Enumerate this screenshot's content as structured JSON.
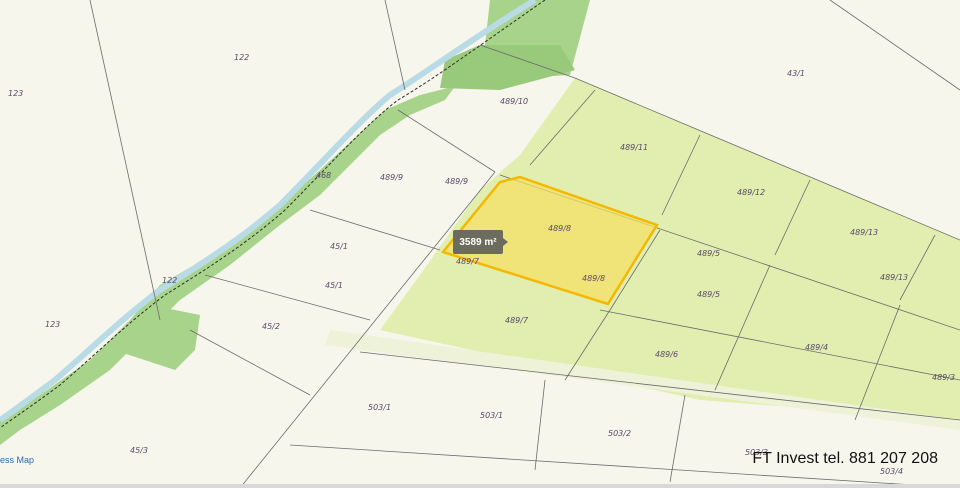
{
  "map": {
    "area_badge": "3589 m²",
    "watermark": "FT Invest tel. 881 207 208",
    "edge_link": "ess Map",
    "parcel_labels": [
      {
        "id": "123",
        "text": "123"
      },
      {
        "id": "122-top",
        "text": "122"
      },
      {
        "id": "122-mid",
        "text": "122"
      },
      {
        "id": "468",
        "text": "468"
      },
      {
        "id": "123-bottom",
        "text": "123"
      },
      {
        "id": "489-10",
        "text": "489/10"
      },
      {
        "id": "489-9-a",
        "text": "489/9"
      },
      {
        "id": "489-9-b",
        "text": "489/9"
      },
      {
        "id": "45-1-a",
        "text": "45/1"
      },
      {
        "id": "45-1-b",
        "text": "45/1"
      },
      {
        "id": "45-2",
        "text": "45/2"
      },
      {
        "id": "45-3",
        "text": "45/3"
      },
      {
        "id": "489-11",
        "text": "489/11"
      },
      {
        "id": "489-12",
        "text": "489/12"
      },
      {
        "id": "489-13-a",
        "text": "489/13"
      },
      {
        "id": "489-13-b",
        "text": "489/13"
      },
      {
        "id": "489-8-a",
        "text": "489/8"
      },
      {
        "id": "489-8-b",
        "text": "489/8"
      },
      {
        "id": "489-7-a",
        "text": "489/7"
      },
      {
        "id": "489-7-b",
        "text": "489/7"
      },
      {
        "id": "489-5-a",
        "text": "489/5"
      },
      {
        "id": "489-5-b",
        "text": "489/5"
      },
      {
        "id": "489-6",
        "text": "489/6"
      },
      {
        "id": "489-4",
        "text": "489/4"
      },
      {
        "id": "489-3",
        "text": "489/3"
      },
      {
        "id": "43-1",
        "text": "43/1"
      },
      {
        "id": "503-1-a",
        "text": "503/1"
      },
      {
        "id": "503-1-b",
        "text": "503/1"
      },
      {
        "id": "503-2",
        "text": "503/2"
      },
      {
        "id": "503-3",
        "text": "503/3"
      },
      {
        "id": "503-4",
        "text": "503/4"
      }
    ]
  }
}
